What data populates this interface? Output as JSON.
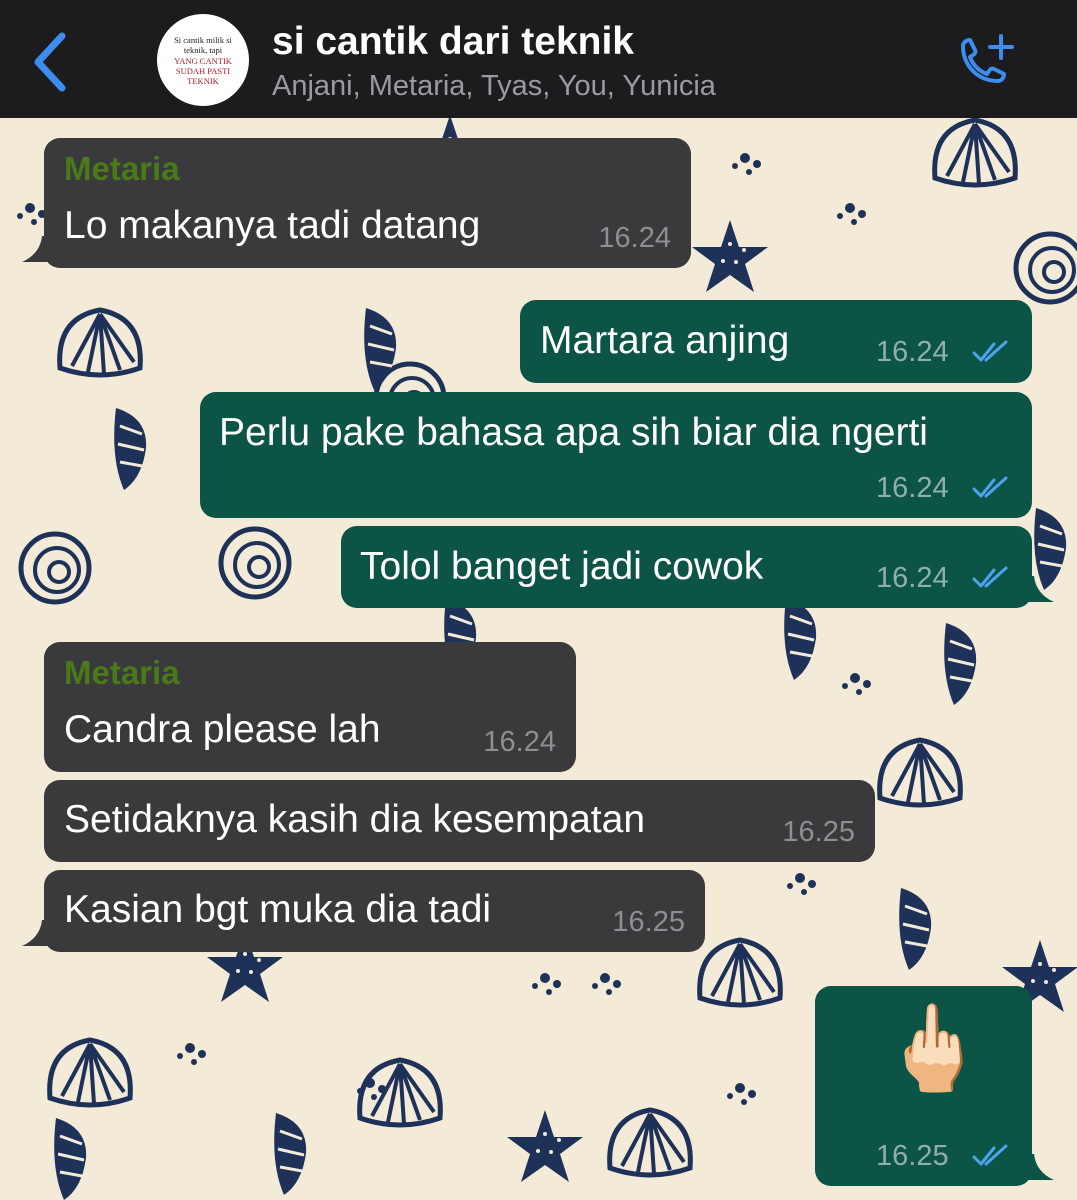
{
  "header": {
    "title": "si cantik dari teknik",
    "participants": "Anjani, Metaria, Tyas, You, Yunicia",
    "avatar_text_line1": "Si cantik milik si teknik, tapi",
    "avatar_text_line2": "YANG CANTIK SUDAH PASTI TEKNIK",
    "back_icon": "chevron-left-icon",
    "call_icon": "phone-add-icon",
    "accent_color": "#3d8cf0"
  },
  "colors": {
    "header_bg": "#1c1c1e",
    "incoming_bubble": "#3a3a3c",
    "outgoing_bubble": "#0c5445",
    "sender_name": "#4a7a18",
    "read_ticks": "#4ea3f0",
    "wallpaper_bg": "#f3ead8",
    "wallpaper_ink": "#1e3158"
  },
  "messages": [
    {
      "sender": "Metaria",
      "text": "Lo makanya tadi datang",
      "time": "16.24"
    },
    {
      "text": "Martara anjing",
      "time": "16.24"
    },
    {
      "text": "Perlu pake bahasa apa sih biar dia ngerti",
      "time": "16.24"
    },
    {
      "text": "Tolol banget jadi cowok",
      "time": "16.24"
    },
    {
      "sender": "Metaria",
      "text": "Candra please lah",
      "time": "16.24"
    },
    {
      "text": "Setidaknya kasih dia kesempatan",
      "time": "16.25"
    },
    {
      "text": "Kasian bgt muka dia tadi",
      "time": "16.25"
    },
    {
      "text": "🖕🏻",
      "time": "16.25"
    }
  ]
}
